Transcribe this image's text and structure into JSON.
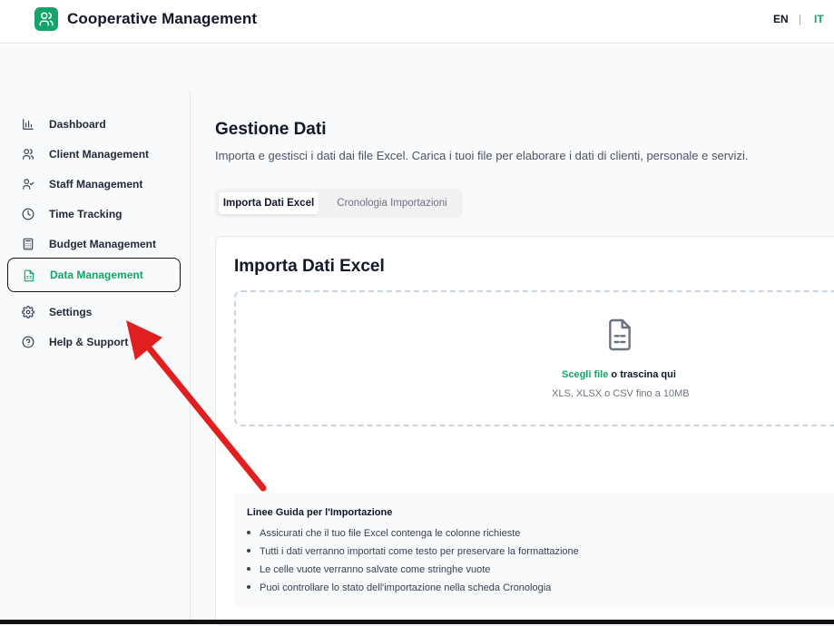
{
  "app": {
    "title": "Cooperative Management",
    "logo_icon": "users-icon",
    "brand_color": "#16a368"
  },
  "language": {
    "en": "EN",
    "separator": "|",
    "it": "IT",
    "active": "IT"
  },
  "sidebar": {
    "items": [
      {
        "label": "Dashboard",
        "icon": "bar-chart-icon",
        "active": false
      },
      {
        "label": "Client Management",
        "icon": "users-icon",
        "active": false
      },
      {
        "label": "Staff Management",
        "icon": "user-check-icon",
        "active": false
      },
      {
        "label": "Time Tracking",
        "icon": "clock-icon",
        "active": false
      },
      {
        "label": "Budget Management",
        "icon": "calculator-icon",
        "active": false
      },
      {
        "label": "Data Management",
        "icon": "file-spreadsheet-icon",
        "active": true
      },
      {
        "label": "Settings",
        "icon": "gear-icon",
        "active": false
      },
      {
        "label": "Help & Support",
        "icon": "help-circle-icon",
        "active": false
      }
    ]
  },
  "page": {
    "title": "Gestione Dati",
    "subtitle": "Importa e gestisci i dati dai file Excel. Carica i tuoi file per elaborare i dati di clienti, personale e servizi."
  },
  "tabs": [
    {
      "label": "Importa Dati Excel",
      "active": true
    },
    {
      "label": "Cronologia Importazioni",
      "active": false
    }
  ],
  "import_card": {
    "title": "Importa Dati Excel",
    "dropzone": {
      "icon": "file-text-icon",
      "choose_link": "Scegli file",
      "choose_rest": " o trascina qui",
      "hint": "XLS, XLSX o CSV fino a 10MB"
    },
    "guidelines": {
      "title": "Linee Guida per l'Importazione",
      "items": [
        "Assicurati che il tuo file Excel contenga le colonne richieste",
        "Tutti i dati verranno importati come testo per preservare la formattazione",
        "Le celle vuote verranno salvate come stringhe vuote",
        "Puoi controllare lo stato dell'importazione nella scheda Cronologia"
      ]
    }
  },
  "annotation": {
    "arrow_color": "#e02020"
  }
}
